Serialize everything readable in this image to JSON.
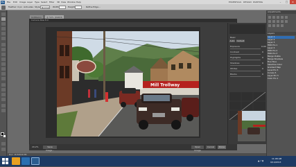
{
  "app": {
    "logo": "Ps",
    "menu": [
      "File",
      "Edit",
      "Image",
      "Layer",
      "Type",
      "Select",
      "Filter",
      "3D",
      "View",
      "Window",
      "Help"
    ],
    "workspace_tabs": [
      "ESSENTIALS",
      "DESIGN",
      "PAINTING"
    ],
    "window_buttons": {
      "minimize": "–",
      "maximize": "□",
      "close": "×"
    }
  },
  "options_bar": {
    "items": [
      "Feather: 0 px",
      "Anti-alias",
      "Style:",
      "Normal",
      "Width:",
      "Height:",
      "Refine Edge..."
    ]
  },
  "document": {
    "tab_title": "Untitled-1",
    "tab_title_2": "@ 50% (RGB/8)"
  },
  "dialog": {
    "title": "Camera Raw 8.0",
    "panel_title": "Basic",
    "auto_label": "Auto",
    "default_label": "Default",
    "sliders": [
      {
        "label": "Exposure",
        "value": "0.00"
      },
      {
        "label": "Contrast",
        "value": "0"
      },
      {
        "label": "Highlights",
        "value": "0"
      },
      {
        "label": "Shadows",
        "value": "0"
      },
      {
        "label": "Whites",
        "value": "0"
      },
      {
        "label": "Blacks",
        "value": "0"
      }
    ],
    "buttons": [
      "Save Image...",
      "Open Image",
      "Cancel",
      "Done"
    ],
    "zoom": "29.2%",
    "sign_text": "Mill Trollway"
  },
  "right_panel": {
    "adjustments_title": "Adjustments",
    "layers_title": "Layers",
    "layers": [
      "Layer 1",
      "Layer 2",
      "Layer 3",
      "HDR Pro 1",
      "Layer 4",
      "HDR Pro 2",
      "HDR Pro 3",
      "Merge Visible",
      "Merge Shadows",
      "Fine Tone",
      "Selective Color",
      "Gradient Map",
      "Level Pro 5",
      "Curves 5",
      "Layer Pro 5",
      "Color Pro 1"
    ],
    "selected_index": 0
  },
  "statusbar": {
    "text": "Doc: 16.5M/16.5M"
  },
  "taskbar": {
    "time": "11:08 AM",
    "date": "9/14/2013"
  }
}
